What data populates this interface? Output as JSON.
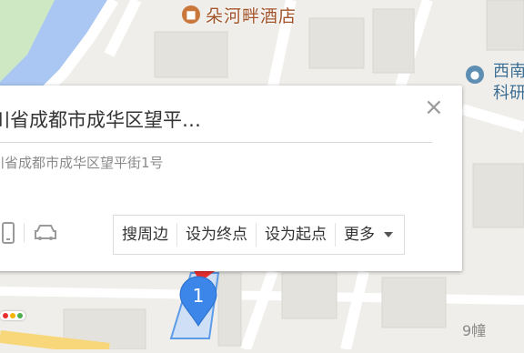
{
  "map": {
    "poi_hotel": "朵河畔酒店",
    "poi_sw_line1": "西南",
    "poi_sw_line2": "科研",
    "building_label": "9幢",
    "marker_number": "1"
  },
  "card": {
    "title": "川省成都市成华区望平…",
    "address": "川省成都市成华区望平街1号",
    "actions": [
      "搜周边",
      "设为终点",
      "设为起点",
      "更多"
    ]
  },
  "icons": {
    "close": "close-icon",
    "phone": "phone-icon",
    "car": "car-icon",
    "hotel": "hotel-icon",
    "school": "school-icon",
    "dropdown": "chevron-down-icon",
    "traffic": "traffic-light-icon"
  },
  "colors": {
    "marker_blue": "#3b86e8",
    "marker_red": "#e8302f",
    "river": "#a9c7f2",
    "park": "#cfe8c4",
    "hotel_text": "#a1532a"
  }
}
